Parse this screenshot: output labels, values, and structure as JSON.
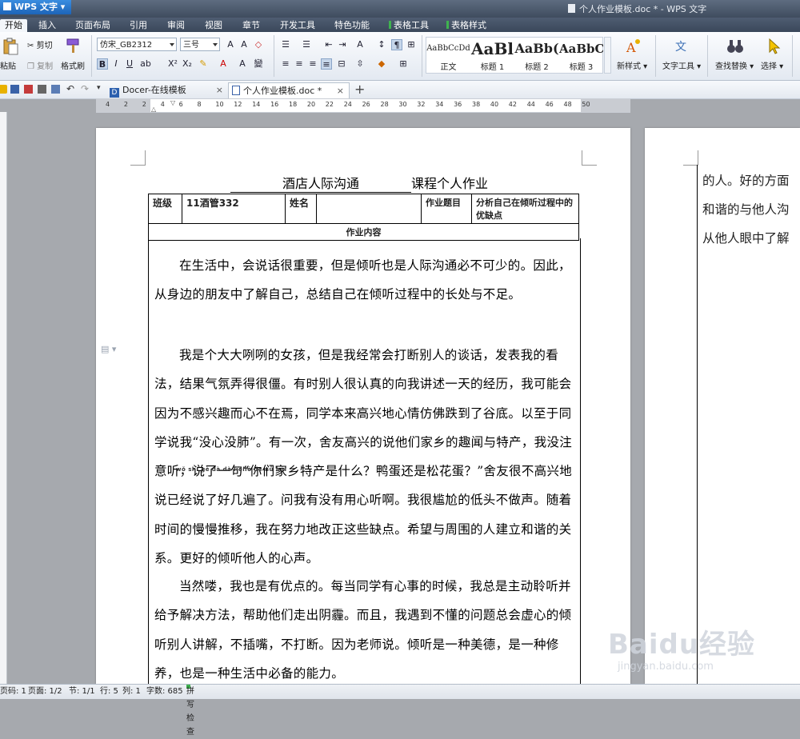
{
  "app": {
    "name": "WPS 文字",
    "window_title": "个人作业模板.doc * - WPS 文字"
  },
  "menu_tabs": [
    "开始",
    "插入",
    "页面布局",
    "引用",
    "审阅",
    "视图",
    "章节",
    "开发工具",
    "特色功能",
    "表格工具",
    "表格样式"
  ],
  "ribbon": {
    "paste": "粘贴",
    "cut": "剪切",
    "copy": "复制",
    "format_painter": "格式刷",
    "font_name": "仿宋_GB2312",
    "font_size": "三号",
    "styles": [
      {
        "preview": "AaBbCcDd",
        "label": "正文"
      },
      {
        "preview": "AaBl",
        "label": "标题 1"
      },
      {
        "preview": "AaBb(",
        "label": "标题 2"
      },
      {
        "preview": "AaBbC",
        "label": "标题 3"
      }
    ],
    "new_style": "新样式",
    "text_tools": "文字工具",
    "find_replace": "查找替换",
    "select": "选择"
  },
  "doc_tabs": [
    {
      "label": "Docer-在线模板"
    },
    {
      "label": "个人作业模板.doc *"
    }
  ],
  "ruler_numbers": [
    "4",
    "2",
    "2",
    "4",
    "6",
    "8",
    "10",
    "12",
    "14",
    "16",
    "18",
    "20",
    "22",
    "24",
    "26",
    "28",
    "30",
    "32",
    "34",
    "36",
    "38",
    "40",
    "42",
    "44",
    "46",
    "48",
    "50"
  ],
  "document": {
    "title_course": "酒店人际沟通",
    "title_suffix": "课程个人作业",
    "table": {
      "class_label": "班级",
      "class_value": "11酒管332",
      "name_label": "姓名",
      "name_value": "",
      "topic_label": "作业题目",
      "topic_value": "分析自己在倾听过程中的优缺点",
      "content_label": "作业内容"
    },
    "pinyin": "wǒ shì gè dà dà liēliē de nǚ hái",
    "paragraphs": [
      "在生活中，会说话很重要，但是倾听也是人际沟通必不可少的。因此，从身边的朋友中了解自己，总结自己在倾听过程中的长处与不足。",
      "我是个大大咧咧的女孩，但是我经常会打断别人的谈话，发表我的看法，结果气氛弄得很僵。有时别人很认真的向我讲述一天的经历，我可能会因为不感兴趣而心不在焉，同学本来高兴地心情仿佛跌到了谷底。以至于同学说我“没心没肺”。有一次，舍友高兴的说他们家乡的趣闻与特产，我没注意听，说了一句“你们家乡特产是什么？鸭蛋还是松花蛋？”舍友很不高兴地说已经说了好几遍了。问我有没有用心听啊。我很尴尬的低头不做声。随着时间的慢慢推移，我在努力地改正这些缺点。希望与周围的人建立和谐的关系。更好的倾听他人的心声。",
      "当然喽，我也是有优点的。每当同学有心事的时候，我总是主动聆听并给予解决方法，帮助他们走出阴霾。而且，我遇到不懂的问题总会虚心的倾听别人讲解，不插嘴，不打断。因为老师说。倾听是一种美德，是一种修养，也是一种生活中必备的能力。"
    ],
    "page2_lines": [
      "的人。好的方面",
      "和谐的与他人沟",
      "从他人眼中了解"
    ]
  },
  "status": {
    "page_code": "页码: 1",
    "page": "页面: 1/2",
    "section": "节: 1/1",
    "row": "行: 5",
    "col": "列: 1",
    "word_count": "字数: 685",
    "spell_check": "拼写检查"
  },
  "watermark": {
    "logo": "Baidu经验",
    "url": "jingyan.baidu.com"
  },
  "colors": {
    "accent": "#1d64b8",
    "titlebar": "#3f4c5e",
    "ribbon_bg": "#e3e9f1",
    "table_tool_mark": "#3fb34f"
  }
}
